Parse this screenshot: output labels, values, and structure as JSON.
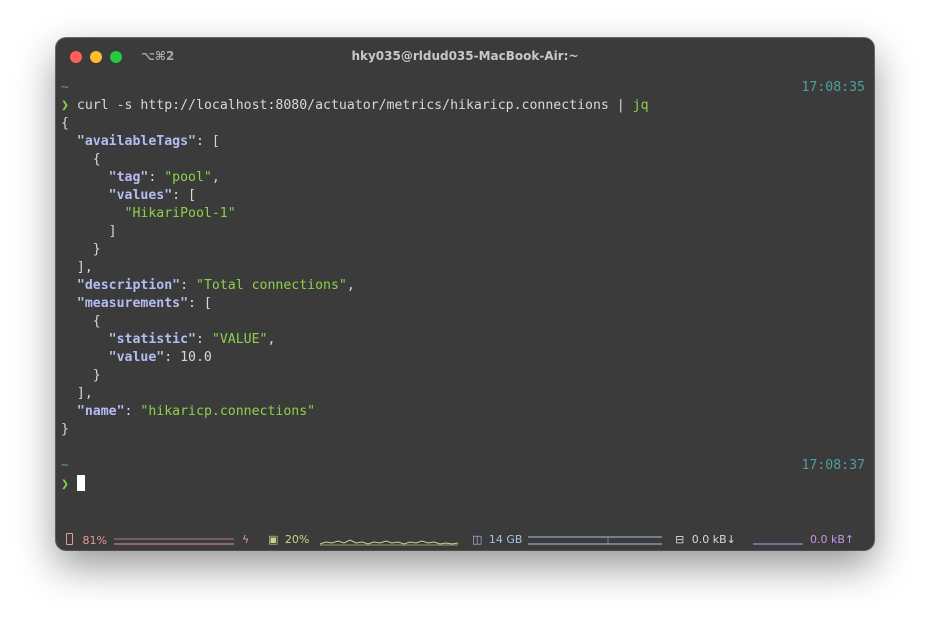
{
  "window": {
    "shortcut": "⌥⌘2",
    "title": "hky035@rldud035-MacBook-Air:~"
  },
  "terminal": {
    "prompt1": {
      "dir": "~",
      "time": "17:08:35"
    },
    "command": {
      "symbol": "❯",
      "text": "curl -s http://localhost:8080/actuator/metrics/hikaricp.connections |",
      "pipe_target": "jq"
    },
    "output": {
      "l1": "{",
      "availableTags_key": "\"availableTags\"",
      "l3": "{",
      "tag_key": "\"tag\"",
      "tag_val": "\"pool\"",
      "values_key": "\"values\"",
      "values_item": "\"HikariPool-1\"",
      "l7": "]",
      "l8": "}",
      "l9": "],",
      "description_key": "\"description\"",
      "description_val": "\"Total connections\"",
      "measurements_key": "\"measurements\"",
      "l12": "{",
      "statistic_key": "\"statistic\"",
      "statistic_val": "\"VALUE\"",
      "value_key": "\"value\"",
      "value_val": "10.0",
      "l15": "}",
      "l16": "],",
      "name_key": "\"name\"",
      "name_val": "\"hikaricp.connections\"",
      "l18": "}"
    },
    "prompt2": {
      "dir": "~",
      "time": "17:08:37",
      "symbol": "❯"
    }
  },
  "statusbar": {
    "battery": "81%",
    "cpu": "20%",
    "memory": "14 GB",
    "net_down": "0.0 kB↓",
    "net_up": "0.0 kB↑",
    "colors": {
      "battery": "#e49a9a",
      "cpu": "#c9d68a",
      "memory": "#a9c0e6",
      "net_down": "#d8d8d8",
      "net_up": "#c694e8"
    }
  }
}
